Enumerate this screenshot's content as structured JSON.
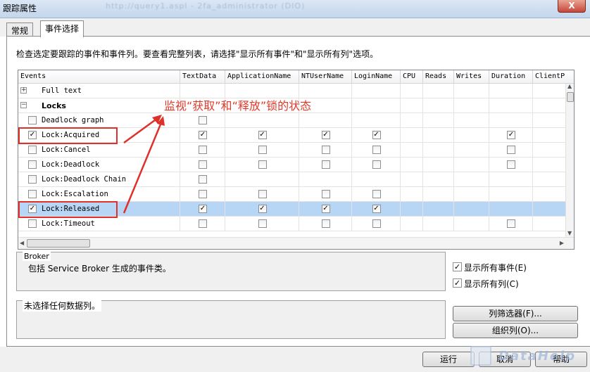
{
  "window": {
    "title": "跟踪属性",
    "blurred_title": "http://query1.aspl - 2fa_administrator (DIO)",
    "close_label": "X"
  },
  "tabs": [
    {
      "label": "常规"
    },
    {
      "label": "事件选择"
    }
  ],
  "description": "检查选定要跟踪的事件和事件列。要查看完整列表，请选择\"显示所有事件\"和\"显示所有列\"选项。",
  "grid": {
    "columns": [
      "Events",
      "TextData",
      "ApplicationName",
      "NTUserName",
      "LoginName",
      "CPU",
      "Reads",
      "Writes",
      "Duration",
      "ClientP"
    ],
    "rows": [
      {
        "label": "Full text",
        "type": "category",
        "expander": "+",
        "checks": [
          "",
          "",
          "",
          "",
          "",
          "",
          "",
          "",
          "",
          ""
        ]
      },
      {
        "label": "Locks",
        "type": "category-bold",
        "expander": "−",
        "checks": [
          "",
          "",
          "",
          "",
          "",
          "",
          "",
          "",
          "",
          ""
        ]
      },
      {
        "label": "Deadlock graph",
        "type": "event",
        "checks": [
          "u",
          "u",
          "",
          "",
          "",
          "",
          "",
          "",
          "",
          ""
        ]
      },
      {
        "label": "Lock:Acquired",
        "type": "event",
        "checks": [
          "c",
          "c",
          "c",
          "c",
          "c",
          "",
          "",
          "",
          "c",
          ""
        ]
      },
      {
        "label": "Lock:Cancel",
        "type": "event",
        "checks": [
          "u",
          "u",
          "u",
          "u",
          "u",
          "",
          "",
          "",
          "u",
          ""
        ]
      },
      {
        "label": "Lock:Deadlock",
        "type": "event",
        "checks": [
          "u",
          "u",
          "u",
          "u",
          "u",
          "",
          "",
          "",
          "u",
          ""
        ]
      },
      {
        "label": "Lock:Deadlock Chain",
        "type": "event",
        "checks": [
          "u",
          "u",
          "",
          "",
          "",
          "",
          "",
          "",
          "",
          ""
        ]
      },
      {
        "label": "Lock:Escalation",
        "type": "event",
        "checks": [
          "u",
          "u",
          "u",
          "u",
          "u",
          "",
          "",
          "",
          "",
          ""
        ]
      },
      {
        "label": "Lock:Released",
        "type": "event",
        "selected": true,
        "checks": [
          "c",
          "c",
          "c",
          "c",
          "c",
          "",
          "",
          "",
          "",
          ""
        ]
      },
      {
        "label": "Lock:Timeout",
        "type": "event",
        "checks": [
          "u",
          "u",
          "u",
          "u",
          "u",
          "",
          "",
          "",
          "u",
          ""
        ]
      }
    ]
  },
  "annotation": "监视“获取”和“释放”锁的状态",
  "broker": {
    "legend": "Broker",
    "text": "包括 Service Broker 生成的事件类。"
  },
  "no_columns": "未选择任何数据列。",
  "options": {
    "show_all_events": "显示所有事件(E)",
    "show_all_columns": "显示所有列(C)"
  },
  "buttons": {
    "column_filter": "列筛选器(F)...",
    "organize_columns": "组织列(O)...",
    "run": "运行",
    "cancel": "取消",
    "help": "帮助"
  },
  "watermark": "DataHelp",
  "colors": {
    "annotation_red": "#e0302a",
    "selected_row": "#b7d6f5"
  }
}
